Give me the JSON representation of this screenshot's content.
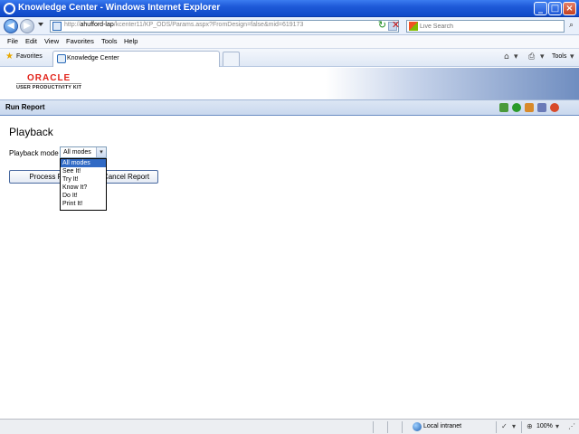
{
  "window": {
    "title": "Knowledge Center - Windows Internet Explorer"
  },
  "address": {
    "url_prefix": "http://",
    "url_host": "ahufford-lap",
    "url_rest": "/kcenter11/KP_ODS/Params.aspx?FromDesign=false&mid=619173"
  },
  "search": {
    "placeholder": "Live Search"
  },
  "menu": {
    "items": [
      "File",
      "Edit",
      "View",
      "Favorites",
      "Tools",
      "Help"
    ]
  },
  "favorites": {
    "label": "Favorites",
    "tab_label": "Knowledge Center",
    "tools_label": "Tools"
  },
  "banner": {
    "brand": "ORACLE",
    "product": "USER PRODUCTIVITY KIT"
  },
  "header": {
    "title": "Run Report"
  },
  "page": {
    "title": "Playback",
    "playback_label": "Playback mode",
    "selected_mode": "All modes",
    "modes": [
      "All modes",
      "See It!",
      "Try It!",
      "Know It?",
      "Do It!",
      "Print It!"
    ],
    "process_label": "Process Report",
    "cancel_label": "Cancel Report"
  },
  "status": {
    "zone": "Local intranet",
    "zoom": "100%"
  },
  "colors": {
    "titlebar": "#1e5ad8",
    "header": "#c9d8ee",
    "selection": "#316ac5",
    "brand": "#e2231a"
  }
}
